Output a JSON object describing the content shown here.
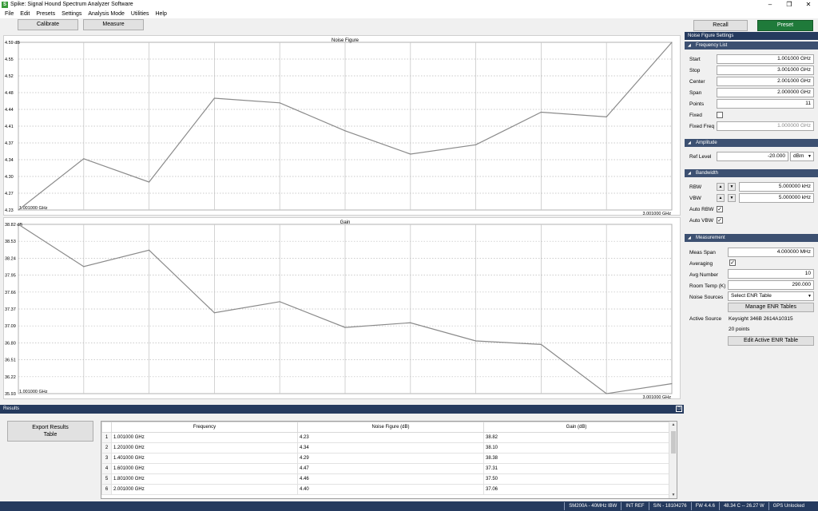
{
  "window": {
    "title": "Spike: Signal Hound Spectrum Analyzer Software"
  },
  "menu": [
    "File",
    "Edit",
    "Presets",
    "Settings",
    "Analysis Mode",
    "Utilities",
    "Help"
  ],
  "toolbar": {
    "calibrate": "Calibrate",
    "measure": "Measure",
    "recall": "Recall",
    "preset": "Preset"
  },
  "charts": {
    "noise_figure": {
      "title": "Noise Figure",
      "top_label": "4.59 dB",
      "y_ticks": [
        "4.55",
        "4.52",
        "4.48",
        "4.44",
        "4.41",
        "4.37",
        "4.34",
        "4.30",
        "4.27",
        "4.23"
      ],
      "x_start": "1.001000 GHz",
      "x_stop": "3.001000 GHz"
    },
    "gain": {
      "title": "Gain",
      "top_label": "38.82 dB",
      "y_ticks": [
        "38.53",
        "38.24",
        "37.95",
        "37.66",
        "37.37",
        "37.09",
        "36.80",
        "36.51",
        "36.22",
        "35.93"
      ],
      "x_start": "1.001000 GHz",
      "x_stop": "3.001000 GHz"
    }
  },
  "chart_data": [
    {
      "type": "line",
      "title": "Noise Figure",
      "ylim": [
        4.23,
        4.59
      ],
      "x": [
        1.001,
        1.201,
        1.401,
        1.601,
        1.801,
        2.001,
        2.201,
        2.401,
        2.601,
        2.801,
        3.001
      ],
      "values": [
        4.23,
        4.34,
        4.29,
        4.47,
        4.46,
        4.4,
        4.35,
        4.37,
        4.44,
        4.43,
        4.59
      ],
      "grid": true
    },
    {
      "type": "line",
      "title": "Gain",
      "ylim": [
        35.93,
        38.82
      ],
      "x": [
        1.001,
        1.201,
        1.401,
        1.601,
        1.801,
        2.001,
        2.201,
        2.401,
        2.601,
        2.801,
        3.001
      ],
      "values": [
        38.82,
        38.1,
        38.38,
        37.31,
        37.5,
        37.06,
        37.14,
        36.83,
        36.77,
        35.93,
        36.1
      ],
      "grid": true
    }
  ],
  "results": {
    "title": "Results",
    "export_button": "Export Results Table",
    "columns": [
      "Frequency",
      "Noise Figure (dB)",
      "Gain (dB)"
    ],
    "rows": [
      [
        "1",
        "1.001000 GHz",
        "4.23",
        "38.82"
      ],
      [
        "2",
        "1.201000 GHz",
        "4.34",
        "38.10"
      ],
      [
        "3",
        "1.401000 GHz",
        "4.29",
        "38.38"
      ],
      [
        "4",
        "1.601000 GHz",
        "4.47",
        "37.31"
      ],
      [
        "5",
        "1.801000 GHz",
        "4.46",
        "37.50"
      ],
      [
        "6",
        "2.001000 GHz",
        "4.40",
        "37.06"
      ]
    ]
  },
  "panel": {
    "title": "Noise Figure Settings",
    "frequency_list": {
      "header": "Frequency List",
      "start_label": "Start",
      "start": "1.001000 GHz",
      "stop_label": "Stop",
      "stop": "3.001000 GHz",
      "center_label": "Center",
      "center": "2.001000 GHz",
      "span_label": "Span",
      "span": "2.000000 GHz",
      "points_label": "Points",
      "points": "11",
      "fixed_label": "Fixed",
      "fixed_freq_label": "Fixed Freq",
      "fixed_freq": "1.000000 GHz"
    },
    "amplitude": {
      "header": "Amplitude",
      "ref_level_label": "Ref Level",
      "ref_level": "-20.000",
      "unit": "dBm"
    },
    "bandwidth": {
      "header": "Bandwidth",
      "rbw_label": "RBW",
      "rbw": "5.000000 kHz",
      "vbw_label": "VBW",
      "vbw": "5.000000 kHz",
      "auto_rbw_label": "Auto RBW",
      "auto_vbw_label": "Auto VBW"
    },
    "measurement": {
      "header": "Measurement",
      "meas_span_label": "Meas Span",
      "meas_span": "4.000000 MHz",
      "averaging_label": "Averaging",
      "avg_number_label": "Avg Number",
      "avg_number": "10",
      "room_temp_label": "Room Temp (K)",
      "room_temp": "290.000",
      "noise_sources_label": "Noise Sources",
      "noise_sources": "Select ENR Table",
      "manage_enr": "Manage ENR Tables",
      "active_source_label": "Active Source",
      "active_source": "Keysight 346B 2614A10315",
      "points": "20 points",
      "edit_enr": "Edit Active ENR Table"
    }
  },
  "status": [
    "SM200A - 40MHz IBW",
    "INT REF",
    "S/N - 18104276",
    "FW 4.4.6",
    "48.34 C -- 26.27 W",
    "GPS Unlocked"
  ]
}
